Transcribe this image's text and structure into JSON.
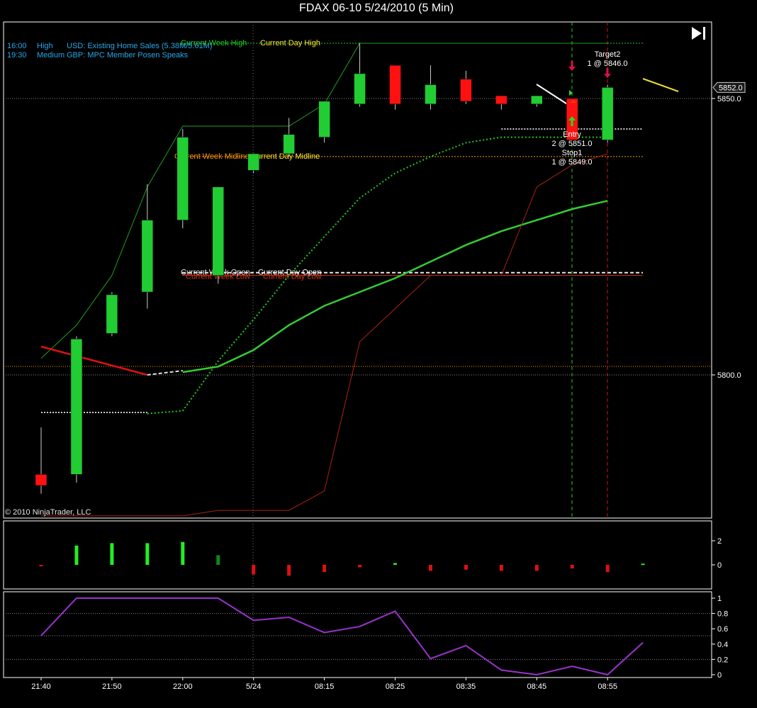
{
  "window": {
    "title": "FDAX 06-10  5/24/2010 (5 Min)"
  },
  "news": [
    {
      "time": "16:00",
      "importance": "High",
      "event": "USD: Existing Home Sales (5.38M/5.61M)"
    },
    {
      "time": "19:30",
      "importance": "Medium",
      "event": "GBP: MPC Member Posen Speaks"
    }
  ],
  "copyright": "© 2010 NinjaTrader, LLC",
  "colors": {
    "up": "#22cc33",
    "down": "#ff1111",
    "axis": "#ffffff",
    "grid": "#8a8a8a",
    "news": "#27a9e8",
    "week_high": "#22cc22",
    "midline": "#ff9900",
    "low_level": "#dd3311",
    "purple": "#9933cc"
  },
  "chart_data": [
    {
      "type": "candlestick",
      "title": "FDAX 06-10  5/24/2010 (5 Min)",
      "x_tick_labels": [
        "21:40",
        "21:50",
        "22:00",
        "5/24",
        "08:15",
        "08:25",
        "08:35",
        "08:45",
        "08:55"
      ],
      "y_tick_labels": [
        "5850.0",
        "5800.0"
      ],
      "price_marker": "5852.0",
      "bars": [
        {
          "o": 5782.0,
          "h": 5790.5,
          "l": 5778.5,
          "c": 5780.0
        },
        {
          "o": 5782.0,
          "h": 5807.0,
          "l": 5780.5,
          "c": 5806.5
        },
        {
          "o": 5807.5,
          "h": 5815.0,
          "l": 5807.0,
          "c": 5814.5
        },
        {
          "o": 5815.0,
          "h": 5834.5,
          "l": 5812.0,
          "c": 5828.0
        },
        {
          "o": 5828.0,
          "h": 5844.5,
          "l": 5826.5,
          "c": 5843.0
        },
        {
          "o": 5818.0,
          "h": 5828.5,
          "l": 5816.5,
          "c": 5834.0
        },
        {
          "o": 5837.0,
          "h": 5837.5,
          "l": 5836.5,
          "c": 5840.0
        },
        {
          "o": 5840.0,
          "h": 5846.5,
          "l": 5839.5,
          "c": 5843.5
        },
        {
          "o": 5843.0,
          "h": 5849.5,
          "l": 5842.0,
          "c": 5849.5
        },
        {
          "o": 5849.0,
          "h": 5860.0,
          "l": 5848.5,
          "c": 5854.5
        },
        {
          "o": 5856.0,
          "h": 5856.0,
          "l": 5848.0,
          "c": 5849.0
        },
        {
          "o": 5849.0,
          "h": 5856.0,
          "l": 5848.0,
          "c": 5852.5
        },
        {
          "o": 5853.5,
          "h": 5855.0,
          "l": 5849.0,
          "c": 5849.5
        },
        {
          "o": 5850.5,
          "h": 5850.5,
          "l": 5848.0,
          "c": 5849.0
        },
        {
          "o": 5849.0,
          "h": 5850.5,
          "l": 5848.5,
          "c": 5850.5
        },
        {
          "o": 5850.0,
          "h": 5850.0,
          "l": 5843.0,
          "c": 5842.5
        },
        {
          "o": 5842.5,
          "h": 5852.5,
          "l": 5842.0,
          "c": 5852.0
        }
      ],
      "levels": [
        {
          "labels": [
            "Current Week High",
            "Current Day High"
          ],
          "value": 5860.0,
          "color": "#22cc22",
          "style": "dotted"
        },
        {
          "labels": [
            "Current Week Midline",
            "Current Day Midline"
          ],
          "value": 5839.5,
          "color": "#ff9900",
          "style": "dotted"
        },
        {
          "labels": [
            "Current Week Open",
            "Current Day Open"
          ],
          "value": 5818.5,
          "color": "#e6e6e6",
          "style": "dashed"
        },
        {
          "labels": [
            "Current Week Low",
            "Current Day Low"
          ],
          "value": 5818.0,
          "color": "#dd3311",
          "style": "solid"
        }
      ],
      "series": [
        {
          "style": "thin green line",
          "values": [
            5803,
            5809,
            5818,
            5834,
            5845,
            5845,
            5845,
            5845,
            5849,
            5860,
            5860,
            5860,
            5860,
            5860,
            5860,
            5860,
            5860
          ]
        },
        {
          "style": "green dotted line",
          "values": [
            null,
            null,
            null,
            5793,
            5793.5,
            5802.5,
            5810,
            5818,
            5825,
            5832,
            5836.5,
            5839.5,
            5842,
            5843,
            5843,
            5843,
            5843
          ]
        },
        {
          "style": "green solid line",
          "values": [
            null,
            null,
            null,
            null,
            5800.5,
            5801.5,
            5804.5,
            5809,
            5812.5,
            5815,
            5817.5,
            5820.5,
            5823.5,
            5826,
            5828,
            5830,
            5831.5
          ]
        },
        {
          "style": "thin dark red line",
          "values": [
            5774.5,
            5774.5,
            5774.5,
            5774.5,
            5774.5,
            5775.5,
            5775.5,
            5775.5,
            5779,
            5806,
            5812,
            5818,
            5818,
            5818,
            5834,
            5838,
            5840
          ]
        }
      ],
      "trade_markers": [
        {
          "text": "Target2",
          "detail": "1 @ 5846.0",
          "bar": 16
        },
        {
          "text": "Entry",
          "detail": "2 @ 5851.0",
          "bar": 15
        },
        {
          "text": "Stop1",
          "detail": "1 @ 5849.0",
          "bar": 15
        }
      ]
    },
    {
      "type": "bar",
      "y_tick_labels": [
        "2",
        "0"
      ],
      "values": [
        -0.1,
        1.6,
        1.8,
        1.8,
        1.9,
        0.8,
        -0.8,
        -0.9,
        -0.6,
        -0.2,
        0.15,
        -0.5,
        -0.4,
        -0.5,
        -0.5,
        -0.3,
        -0.6,
        0.1
      ]
    },
    {
      "type": "line",
      "y_tick_labels": [
        "1",
        "0.8",
        "0.6",
        "0.4",
        "0.2",
        "0"
      ],
      "ylim": [
        0,
        1
      ],
      "values": [
        0.51,
        1.0,
        1.0,
        1.0,
        1.0,
        1.0,
        0.71,
        0.75,
        0.55,
        0.63,
        0.83,
        0.21,
        0.38,
        0.06,
        0.0,
        0.11,
        0.0,
        0.42
      ]
    }
  ]
}
